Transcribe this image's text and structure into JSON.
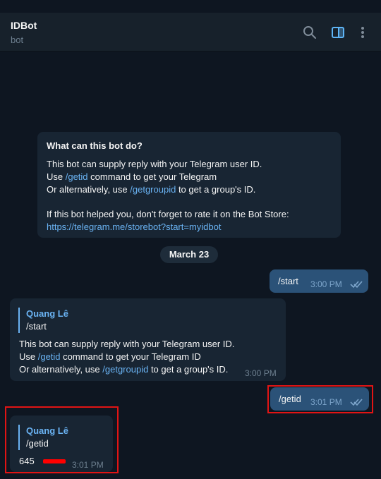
{
  "header": {
    "title": "IDBot",
    "subtitle": "bot"
  },
  "header_icons": [
    "search-icon",
    "sidebar-toggle-icon",
    "more-vert-icon"
  ],
  "colors": {
    "accent": "#6ab3f3",
    "outgoing_bubble": "#2b5278",
    "incoming_bubble": "#182533",
    "highlight": "#e11414",
    "background": "#0e1621"
  },
  "intro": {
    "title": "What can this bot do?",
    "line1": "This bot can supply reply with your Telegram user ID.",
    "line2_pre": "Use ",
    "line2_link": "/getid",
    "line2_post": " command to get your Telegram",
    "line3_pre": "Or alternatively, use ",
    "line3_link": "/getgroupid",
    "line3_post": " to get a group's ID.",
    "line4": "If this bot helped you, don't forget to rate it on the Bot Store:",
    "store_link": "https://telegram.me/storebot?start=myidbot"
  },
  "date_divider": "March 23",
  "messages": {
    "m1": {
      "text": "/start",
      "time": "3:00 PM"
    },
    "m2": {
      "quote_name": "Quang Lê",
      "quote_text": "/start",
      "line1": "This bot can supply reply with your Telegram user ID.",
      "line2_pre": "Use ",
      "line2_link": "/getid",
      "line2_post": " command to get your Telegram ID",
      "line3_pre": "Or alternatively, use ",
      "line3_link": "/getgroupid",
      "line3_post": " to get a group's ID.",
      "time": "3:00 PM"
    },
    "m3": {
      "text": "/getid",
      "time": "3:01 PM"
    },
    "m4": {
      "quote_name": "Quang Lê",
      "quote_text": "/getid",
      "id_visible": "645",
      "time": "3:01 PM"
    }
  }
}
